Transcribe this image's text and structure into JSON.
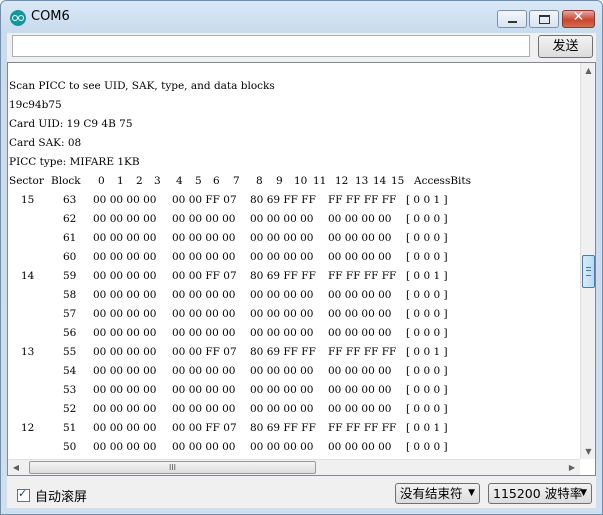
{
  "window": {
    "title": "COM6"
  },
  "toolbar": {
    "send_label": "发送",
    "input_value": ""
  },
  "output": {
    "lines": [
      "Scan PICC to see UID, SAK, type, and data blocks",
      "19c94b75",
      "Card UID: 19 C9 4B 75",
      "Card SAK: 08",
      "PICC type: MIFARE 1KB"
    ],
    "headers": [
      "Sector",
      "Block",
      "0",
      "1",
      "2",
      "3",
      "4",
      "5",
      "6",
      "7",
      "8",
      "9",
      "10",
      "11",
      "12",
      "13",
      "14",
      "15",
      "AccessBits"
    ],
    "rows": [
      {
        "sector": "15",
        "block": "63",
        "g1": "00 00 00 00",
        "g2": "00 00 FF 07",
        "g3": "80 69 FF FF",
        "g4": "FF FF FF FF",
        "access": "[ 0 0 1 ]"
      },
      {
        "sector": "",
        "block": "62",
        "g1": "00 00 00 00",
        "g2": "00 00 00 00",
        "g3": "00 00 00 00",
        "g4": "00 00 00 00",
        "access": "[ 0 0 0 ]"
      },
      {
        "sector": "",
        "block": "61",
        "g1": "00 00 00 00",
        "g2": "00 00 00 00",
        "g3": "00 00 00 00",
        "g4": "00 00 00 00",
        "access": "[ 0 0 0 ]"
      },
      {
        "sector": "",
        "block": "60",
        "g1": "00 00 00 00",
        "g2": "00 00 00 00",
        "g3": "00 00 00 00",
        "g4": "00 00 00 00",
        "access": "[ 0 0 0 ]"
      },
      {
        "sector": "14",
        "block": "59",
        "g1": "00 00 00 00",
        "g2": "00 00 FF 07",
        "g3": "80 69 FF FF",
        "g4": "FF FF FF FF",
        "access": "[ 0 0 1 ]"
      },
      {
        "sector": "",
        "block": "58",
        "g1": "00 00 00 00",
        "g2": "00 00 00 00",
        "g3": "00 00 00 00",
        "g4": "00 00 00 00",
        "access": "[ 0 0 0 ]"
      },
      {
        "sector": "",
        "block": "57",
        "g1": "00 00 00 00",
        "g2": "00 00 00 00",
        "g3": "00 00 00 00",
        "g4": "00 00 00 00",
        "access": "[ 0 0 0 ]"
      },
      {
        "sector": "",
        "block": "56",
        "g1": "00 00 00 00",
        "g2": "00 00 00 00",
        "g3": "00 00 00 00",
        "g4": "00 00 00 00",
        "access": "[ 0 0 0 ]"
      },
      {
        "sector": "13",
        "block": "55",
        "g1": "00 00 00 00",
        "g2": "00 00 FF 07",
        "g3": "80 69 FF FF",
        "g4": "FF FF FF FF",
        "access": "[ 0 0 1 ]"
      },
      {
        "sector": "",
        "block": "54",
        "g1": "00 00 00 00",
        "g2": "00 00 00 00",
        "g3": "00 00 00 00",
        "g4": "00 00 00 00",
        "access": "[ 0 0 0 ]"
      },
      {
        "sector": "",
        "block": "53",
        "g1": "00 00 00 00",
        "g2": "00 00 00 00",
        "g3": "00 00 00 00",
        "g4": "00 00 00 00",
        "access": "[ 0 0 0 ]"
      },
      {
        "sector": "",
        "block": "52",
        "g1": "00 00 00 00",
        "g2": "00 00 00 00",
        "g3": "00 00 00 00",
        "g4": "00 00 00 00",
        "access": "[ 0 0 0 ]"
      },
      {
        "sector": "12",
        "block": "51",
        "g1": "00 00 00 00",
        "g2": "00 00 FF 07",
        "g3": "80 69 FF FF",
        "g4": "FF FF FF FF",
        "access": "[ 0 0 1 ]"
      },
      {
        "sector": "",
        "block": "50",
        "g1": "00 00 00 00",
        "g2": "00 00 00 00",
        "g3": "00 00 00 00",
        "g4": "00 00 00 00",
        "access": "[ 0 0 0 ]"
      }
    ]
  },
  "footer": {
    "autoscroll_label": "自动滚屏",
    "autoscroll_checked": true,
    "line_ending": "没有结束符",
    "baud": "115200 波特率"
  },
  "icons": {
    "app": "arduino-icon",
    "scroll_up": "arrow-up-icon",
    "scroll_down": "arrow-down-icon",
    "scroll_left": "arrow-left-icon",
    "scroll_right": "arrow-right-icon",
    "dropdown": "chevron-down-icon"
  }
}
